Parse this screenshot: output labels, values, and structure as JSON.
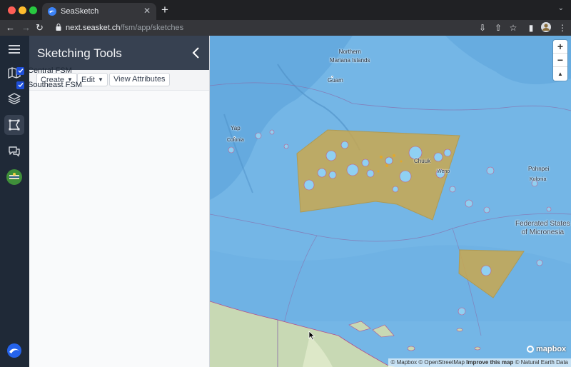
{
  "browser": {
    "tab_title": "SeaSketch",
    "url_host": "next.seasket.ch",
    "url_path": "/fsm/app/sketches"
  },
  "rail": {
    "items": [
      "menu-icon",
      "map-icon",
      "layers-icon",
      "sketch-icon",
      "forum-icon",
      "project-logo"
    ],
    "active": "sketch-icon"
  },
  "panel": {
    "title": "Sketching Tools",
    "toolbar": {
      "create_label": "Create",
      "edit_label": "Edit",
      "view_attributes_label": "View Attributes"
    },
    "sketches": [
      {
        "name": "Central FSM",
        "checked": true
      },
      {
        "name": "Southeast FSM",
        "checked": true
      }
    ]
  },
  "map": {
    "labels": {
      "northern_mariana": "Northern\nMariana Islands",
      "guam": "Guam",
      "yap": "Yap",
      "colonia": "Colonia",
      "chuuk": "Chuuk",
      "weno": "Weno",
      "pohnpei": "Pohnpei",
      "kolonia": "Kolonia",
      "fsm": "Federated States\nof Micronesia"
    },
    "zoom_in": "+",
    "zoom_out": "−",
    "reset_north": "▲",
    "logo_text": "mapbox",
    "attribution": {
      "mapbox": "© Mapbox",
      "osm": "© OpenStreetMap",
      "improve": "Improve this map",
      "natural_earth": "© Natural Earth Data"
    },
    "colors": {
      "ocean": "#74b6e6",
      "sketch_fill": "#c9a850",
      "land": "#c8d9b4"
    }
  }
}
